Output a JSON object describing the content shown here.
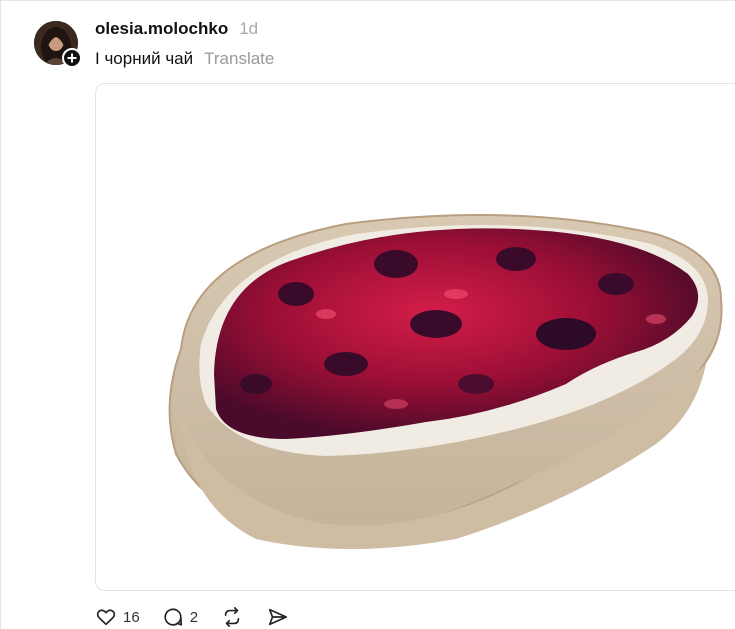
{
  "post": {
    "username": "olesia.molochko",
    "time": "1d",
    "text": "І чорний чай",
    "translate_label": "Translate"
  },
  "actions": {
    "likes": "16",
    "replies": "2"
  },
  "icons": {
    "follow": "plus-icon",
    "like": "heart-icon",
    "reply": "comment-icon",
    "repost": "repost-icon",
    "share": "share-icon"
  },
  "media": {
    "image": "bread-slice-with-berry-jam"
  }
}
